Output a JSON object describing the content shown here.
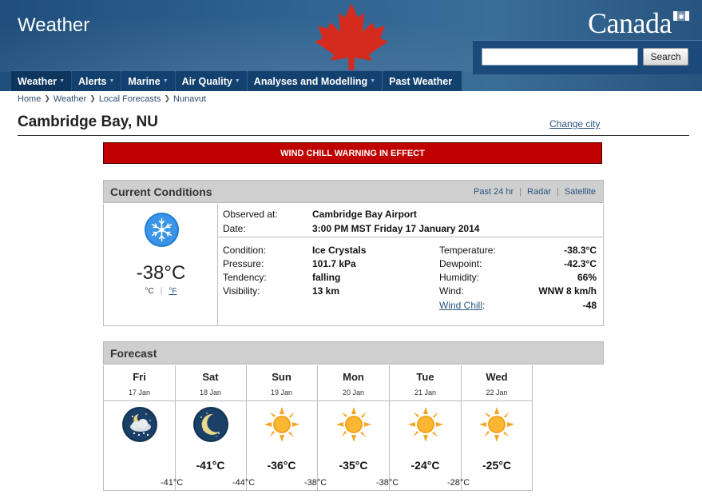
{
  "header": {
    "app_title": "Weather",
    "wordmark": "Canada",
    "search": {
      "value": "",
      "button_label": "Search"
    }
  },
  "nav": [
    {
      "label": "Weather",
      "has_menu": true
    },
    {
      "label": "Alerts",
      "has_menu": true
    },
    {
      "label": "Marine",
      "has_menu": true
    },
    {
      "label": "Air Quality",
      "has_menu": true
    },
    {
      "label": "Analyses and Modelling",
      "has_menu": true
    },
    {
      "label": "Past Weather",
      "has_menu": false
    }
  ],
  "breadcrumb": [
    "Home",
    "Weather",
    "Local Forecasts",
    "Nunavut"
  ],
  "page": {
    "title": "Cambridge Bay, NU",
    "change_city": "Change city"
  },
  "warning": "WIND CHILL WARNING IN EFFECT",
  "current_conditions": {
    "heading": "Current Conditions",
    "links": [
      "Past 24 hr",
      "Radar",
      "Satellite"
    ],
    "icon": "ice-crystals-icon",
    "temperature": "-38°C",
    "unit_c": "°C",
    "unit_f": "°F",
    "observed_at_label": "Observed at:",
    "observed_at": "Cambridge Bay Airport",
    "date_label": "Date:",
    "date": "3:00 PM MST Friday 17 January 2014",
    "left": [
      {
        "label": "Condition:",
        "value": "Ice Crystals"
      },
      {
        "label": "Pressure:",
        "value": "101.7 kPa"
      },
      {
        "label": "Tendency:",
        "value": "falling"
      },
      {
        "label": "Visibility:",
        "value": "13 km"
      }
    ],
    "right": [
      {
        "label": "Temperature:",
        "value": "-38.3°C"
      },
      {
        "label": "Dewpoint:",
        "value": "-42.3°C"
      },
      {
        "label": "Humidity:",
        "value": "66%"
      },
      {
        "label": "Wind:",
        "value": "WNW 8 km/h"
      },
      {
        "label": "Wind Chill",
        "suffix": ":",
        "value": "-48"
      }
    ]
  },
  "forecast": {
    "heading": "Forecast",
    "days": [
      {
        "day": "Fri",
        "date": "17 Jan",
        "icon": "cloudy-night-snow-icon",
        "high": ""
      },
      {
        "day": "Sat",
        "date": "18 Jan",
        "icon": "clear-night-moon-icon",
        "high": "-41°C"
      },
      {
        "day": "Sun",
        "date": "19 Jan",
        "icon": "sunny-icon",
        "high": "-36°C"
      },
      {
        "day": "Mon",
        "date": "20 Jan",
        "icon": "sunny-icon",
        "high": "-35°C"
      },
      {
        "day": "Tue",
        "date": "21 Jan",
        "icon": "sunny-icon",
        "high": "-24°C"
      },
      {
        "day": "Wed",
        "date": "22 Jan",
        "icon": "sunny-icon",
        "high": "-25°C"
      }
    ],
    "lows": [
      "-41°C",
      "-44°C",
      "-38°C",
      "-38°C",
      "-28°C"
    ]
  },
  "colors": {
    "header_blue": "#2f6290",
    "nav_blue": "#13416f",
    "warning_red": "#c00000",
    "leaf_red": "#d52b1e",
    "link_blue": "#2a5481",
    "panel_grey": "#cfcfcf"
  }
}
